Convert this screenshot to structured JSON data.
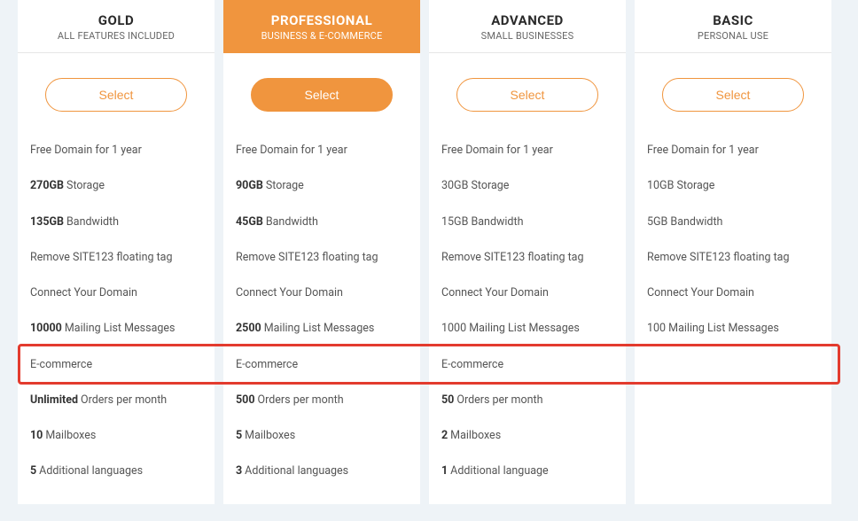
{
  "select_label": "Select",
  "plans": [
    {
      "id": "gold",
      "title": "GOLD",
      "subtitle": "ALL FEATURES INCLUDED",
      "featured": false,
      "features": [
        {
          "bold": "",
          "text": "Free Domain for 1 year"
        },
        {
          "bold": "270GB",
          "text": "Storage"
        },
        {
          "bold": "135GB",
          "text": "Bandwidth"
        },
        {
          "bold": "",
          "text": "Remove SITE123 floating tag"
        },
        {
          "bold": "",
          "text": "Connect Your Domain"
        },
        {
          "bold": "10000",
          "text": "Mailing List Messages"
        },
        {
          "bold": "",
          "text": "E-commerce"
        },
        {
          "bold": "Unlimited",
          "text": "Orders per month"
        },
        {
          "bold": "10",
          "text": "Mailboxes"
        },
        {
          "bold": "5",
          "text": "Additional languages"
        }
      ]
    },
    {
      "id": "professional",
      "title": "PROFESSIONAL",
      "subtitle": "BUSINESS & E-COMMERCE",
      "featured": true,
      "features": [
        {
          "bold": "",
          "text": "Free Domain for 1 year"
        },
        {
          "bold": "90GB",
          "text": "Storage"
        },
        {
          "bold": "45GB",
          "text": "Bandwidth"
        },
        {
          "bold": "",
          "text": "Remove SITE123 floating tag"
        },
        {
          "bold": "",
          "text": "Connect Your Domain"
        },
        {
          "bold": "2500",
          "text": "Mailing List Messages"
        },
        {
          "bold": "",
          "text": "E-commerce"
        },
        {
          "bold": "500",
          "text": "Orders per month"
        },
        {
          "bold": "5",
          "text": "Mailboxes"
        },
        {
          "bold": "3",
          "text": "Additional languages"
        }
      ]
    },
    {
      "id": "advanced",
      "title": "ADVANCED",
      "subtitle": "SMALL BUSINESSES",
      "featured": false,
      "features": [
        {
          "bold": "",
          "text": "Free Domain for 1 year"
        },
        {
          "bold": "",
          "text": "30GB Storage"
        },
        {
          "bold": "",
          "text": "15GB Bandwidth"
        },
        {
          "bold": "",
          "text": "Remove SITE123 floating tag"
        },
        {
          "bold": "",
          "text": "Connect Your Domain"
        },
        {
          "bold": "",
          "text": "1000 Mailing List Messages"
        },
        {
          "bold": "",
          "text": "E-commerce"
        },
        {
          "bold": "50",
          "text": "Orders per month"
        },
        {
          "bold": "2",
          "text": "Mailboxes"
        },
        {
          "bold": "1",
          "text": "Additional language"
        }
      ]
    },
    {
      "id": "basic",
      "title": "BASIC",
      "subtitle": "PERSONAL USE",
      "featured": false,
      "features": [
        {
          "bold": "",
          "text": "Free Domain for 1 year"
        },
        {
          "bold": "",
          "text": "10GB Storage"
        },
        {
          "bold": "",
          "text": "5GB Bandwidth"
        },
        {
          "bold": "",
          "text": "Remove SITE123 floating tag"
        },
        {
          "bold": "",
          "text": "Connect Your Domain"
        },
        {
          "bold": "",
          "text": "100 Mailing List Messages"
        },
        {
          "bold": "",
          "text": ""
        },
        {
          "bold": "",
          "text": ""
        },
        {
          "bold": "",
          "text": ""
        },
        {
          "bold": "",
          "text": ""
        }
      ]
    }
  ],
  "highlight_row_index": 6
}
